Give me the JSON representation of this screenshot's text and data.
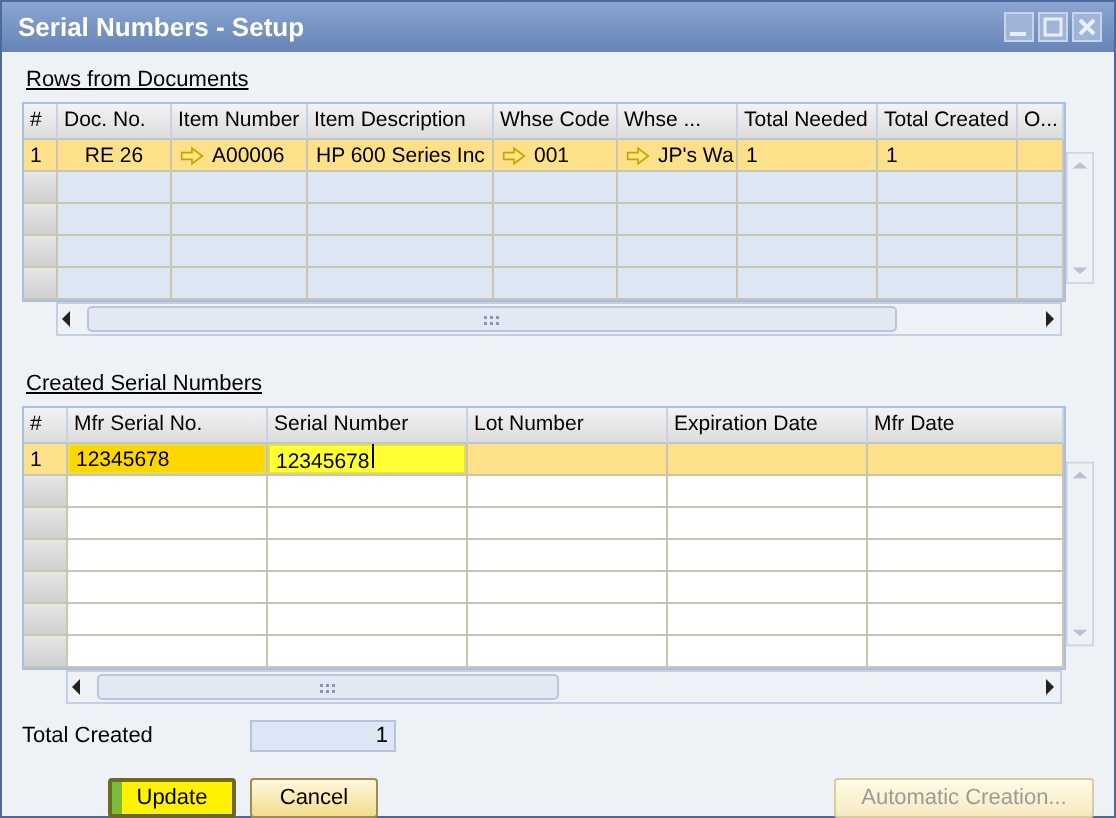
{
  "window": {
    "title": "Serial Numbers - Setup"
  },
  "documents": {
    "heading": "Rows from Documents",
    "columns": [
      "#",
      "Doc. No.",
      "Item Number",
      "Item Description",
      "Whse Code",
      "Whse ...",
      "Total Needed",
      "Total Created",
      "O..."
    ],
    "rows": [
      {
        "selected": true,
        "cells": [
          {
            "text": "1"
          },
          {
            "text": "RE 26"
          },
          {
            "text": "A00006",
            "link": true
          },
          {
            "text": "HP 600 Series Inc"
          },
          {
            "text": "001",
            "link": true
          },
          {
            "text": "JP's Wa",
            "link": true
          },
          {
            "text": "1"
          },
          {
            "text": "1"
          },
          {
            "text": ""
          }
        ]
      }
    ]
  },
  "serials": {
    "heading": "Created Serial Numbers",
    "columns": [
      "#",
      "Mfr Serial No.",
      "Serial Number",
      "Lot Number",
      "Expiration Date",
      "Mfr Date"
    ],
    "rows": [
      {
        "selected": true,
        "cells": [
          {
            "text": "1"
          },
          {
            "text": "12345678",
            "highlight": true
          },
          {
            "text": "12345678",
            "highlight": true,
            "focused": true
          },
          {
            "text": ""
          },
          {
            "text": ""
          },
          {
            "text": ""
          }
        ]
      }
    ]
  },
  "total_created": {
    "label": "Total Created",
    "value": "1"
  },
  "buttons": [
    {
      "label": "Update",
      "default": true,
      "disabled": false
    },
    {
      "label": "Cancel",
      "default": false,
      "disabled": false
    },
    {
      "label": "Automatic Creation...",
      "default": false,
      "disabled": true
    }
  ]
}
